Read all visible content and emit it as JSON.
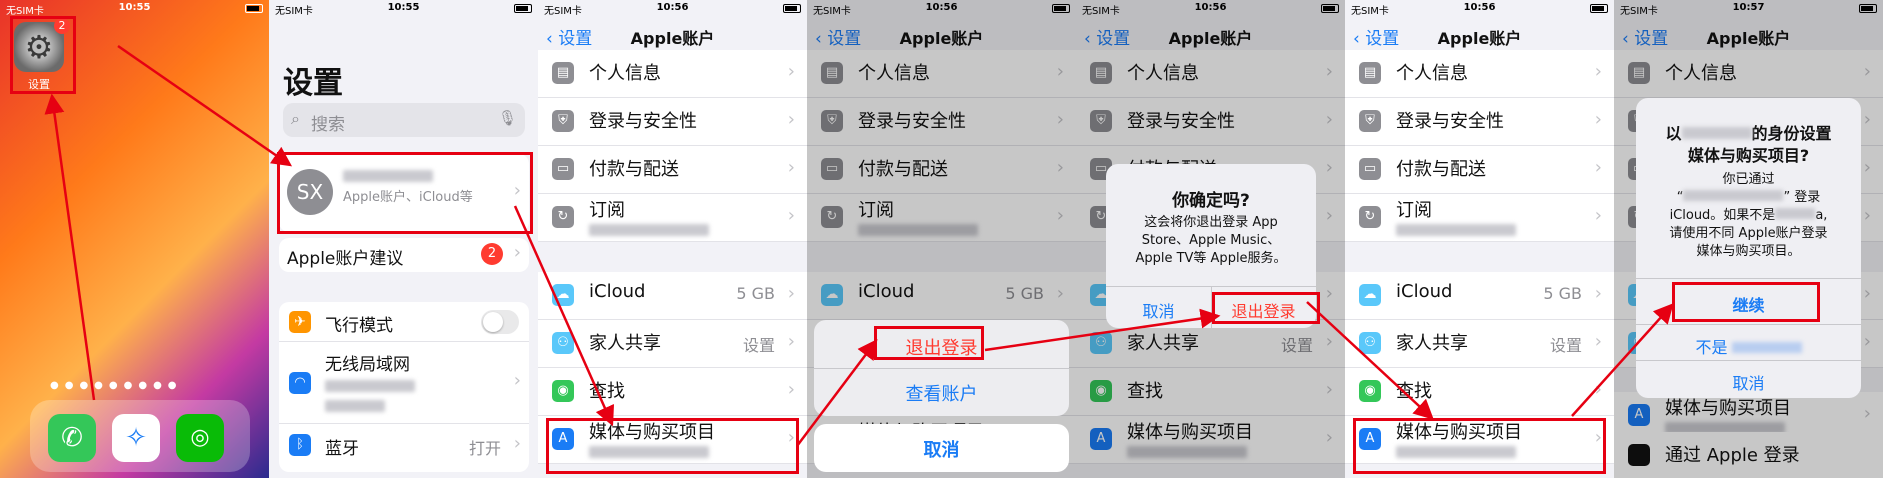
{
  "panel1": {
    "carrier": "无SIM卡",
    "time": "10:55",
    "settings_label": "设置",
    "badge": "2"
  },
  "panel2": {
    "carrier": "无SIM卡",
    "time": "10:55",
    "title": "设置",
    "search_placeholder": "搜索",
    "profile_initials": "SX",
    "profile_sub": "Apple账户、iCloud等",
    "suggestion_label": "Apple账户建议",
    "suggestion_badge": "2",
    "airplane": "飞行模式",
    "wlan": "无线局域网",
    "bluetooth": "蓝牙",
    "bluetooth_value": "打开"
  },
  "common": {
    "back": "设置",
    "title": "Apple账户",
    "personal": "个人信息",
    "security": "登录与安全性",
    "payment": "付款与配送",
    "subscription": "订阅",
    "icloud": "iCloud",
    "icloud_value": "5 GB",
    "family": "家人共享",
    "family_value": "设置",
    "find": "查找",
    "media": "媒体与购买项目",
    "apple_signin": "通过 Apple 登录"
  },
  "panel3": {
    "carrier": "无SIM卡",
    "time": "10:56"
  },
  "panel4": {
    "carrier": "无SIM卡",
    "time": "10:56",
    "signout": "退出登录",
    "view_account": "查看账户",
    "cancel": "取消"
  },
  "panel5": {
    "carrier": "无SIM卡",
    "time": "10:56",
    "alert_title": "你确定吗?",
    "alert_body": "这会将你退出登录 App Store、Apple Music、Apple TV等 Apple服务。",
    "cancel": "取消",
    "signout": "退出登录"
  },
  "panel6": {
    "carrier": "无SIM卡",
    "time": "10:56"
  },
  "panel7": {
    "carrier": "无SIM卡",
    "time": "10:57",
    "alert_title_a": "以",
    "alert_title_b": "的身份设置",
    "alert_title_c": "媒体与购买项目?",
    "alert_line1": "你已通过",
    "alert_line2": "“",
    "alert_line2b": "” 登录",
    "alert_line3": "iCloud。如果不是",
    "alert_line3b": "a,",
    "alert_line4": "请使用不同 Apple账户登录",
    "alert_line5": "媒体与购买项目。",
    "continue": "继续",
    "not_prefix": "不是",
    "cancel": "取消"
  }
}
